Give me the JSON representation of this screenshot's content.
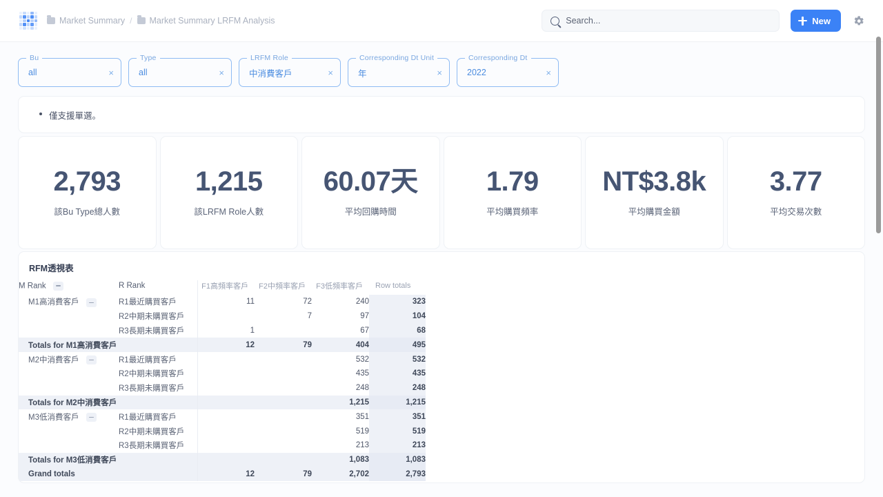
{
  "header": {
    "logo_name": "app-logo",
    "breadcrumbs": [
      {
        "label": "Market Summary"
      },
      {
        "label": "Market Summary LRFM Analysis"
      }
    ],
    "separator": "/",
    "search": {
      "placeholder": "Search...",
      "value": "",
      "icon": "search-icon"
    },
    "new_button": {
      "label": "New",
      "icon": "plus-icon",
      "color": "#3b82f6"
    },
    "settings_icon": "gear-icon"
  },
  "filters": [
    {
      "label": "Bu",
      "value": "all",
      "clear": "×"
    },
    {
      "label": "Type",
      "value": "all",
      "clear": "×"
    },
    {
      "label": "LRFM Role",
      "value": "中消費客戶",
      "clear": "×"
    },
    {
      "label": "Corresponding Dt Unit",
      "value": "年",
      "clear": "×"
    },
    {
      "label": "Corresponding Dt",
      "value": "2022",
      "clear": "×"
    }
  ],
  "note": {
    "text": "僅支援單選。"
  },
  "kpis": [
    {
      "value": "2,793",
      "label": "該Bu Type總人數"
    },
    {
      "value": "1,215",
      "label": "該LRFM Role人數"
    },
    {
      "value": "60.07天",
      "label": "平均回購時間"
    },
    {
      "value": "1.79",
      "label": "平均購買頻率"
    },
    {
      "value": "NT$3.8k",
      "label": "平均購買金額"
    },
    {
      "value": "3.77",
      "label": "平均交易次數"
    }
  ],
  "table": {
    "title": "RFM透視表",
    "headers": {
      "m_rank": "M Rank",
      "r_rank": "R Rank",
      "f1": "F1高頻率客戶",
      "f2": "F2中頻率客戶",
      "f3": "F3低頻率客戶",
      "row_totals": "Row totals"
    },
    "groups": [
      {
        "m": "M1高消費客戶",
        "rows": [
          {
            "r": "R1最近購買客戶",
            "f1": "11",
            "f2": "72",
            "f3": "240",
            "total": "323"
          },
          {
            "r": "R2中期未購買客戶",
            "f1": "",
            "f2": "7",
            "f3": "97",
            "total": "104"
          },
          {
            "r": "R3長期未購買客戶",
            "f1": "1",
            "f2": "",
            "f3": "67",
            "total": "68"
          }
        ],
        "total_label": "Totals for M1高消費客戶",
        "totals": {
          "f1": "12",
          "f2": "79",
          "f3": "404",
          "total": "495"
        }
      },
      {
        "m": "M2中消費客戶",
        "rows": [
          {
            "r": "R1最近購買客戶",
            "f1": "",
            "f2": "",
            "f3": "532",
            "total": "532"
          },
          {
            "r": "R2中期未購買客戶",
            "f1": "",
            "f2": "",
            "f3": "435",
            "total": "435"
          },
          {
            "r": "R3長期未購買客戶",
            "f1": "",
            "f2": "",
            "f3": "248",
            "total": "248"
          }
        ],
        "total_label": "Totals for M2中消費客戶",
        "totals": {
          "f1": "",
          "f2": "",
          "f3": "1,215",
          "total": "1,215"
        }
      },
      {
        "m": "M3低消費客戶",
        "rows": [
          {
            "r": "R1最近購買客戶",
            "f1": "",
            "f2": "",
            "f3": "351",
            "total": "351"
          },
          {
            "r": "R2中期未購買客戶",
            "f1": "",
            "f2": "",
            "f3": "519",
            "total": "519"
          },
          {
            "r": "R3長期未購買客戶",
            "f1": "",
            "f2": "",
            "f3": "213",
            "total": "213"
          }
        ],
        "total_label": "Totals for M3低消費客戶",
        "totals": {
          "f1": "",
          "f2": "",
          "f3": "1,083",
          "total": "1,083"
        }
      }
    ],
    "grand_label": "Grand totals",
    "grand": {
      "f1": "12",
      "f2": "79",
      "f3": "2,702",
      "total": "2,793"
    }
  }
}
